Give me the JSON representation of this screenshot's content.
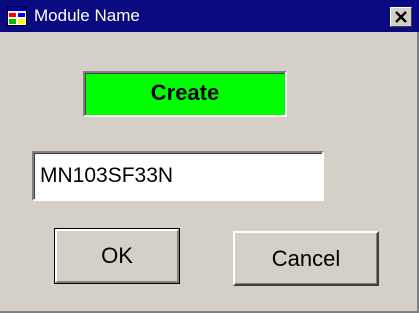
{
  "window": {
    "title": "Module Name",
    "icon": "application-icon",
    "close_icon": "close-icon"
  },
  "mode": {
    "label": "Create",
    "color": "#00ff00"
  },
  "module_name": {
    "value": "MN103SF33N"
  },
  "buttons": {
    "ok_label": "OK",
    "cancel_label": "Cancel"
  },
  "colors": {
    "titlebar": "#0a0a80",
    "dialog": "#d4d0c8"
  }
}
